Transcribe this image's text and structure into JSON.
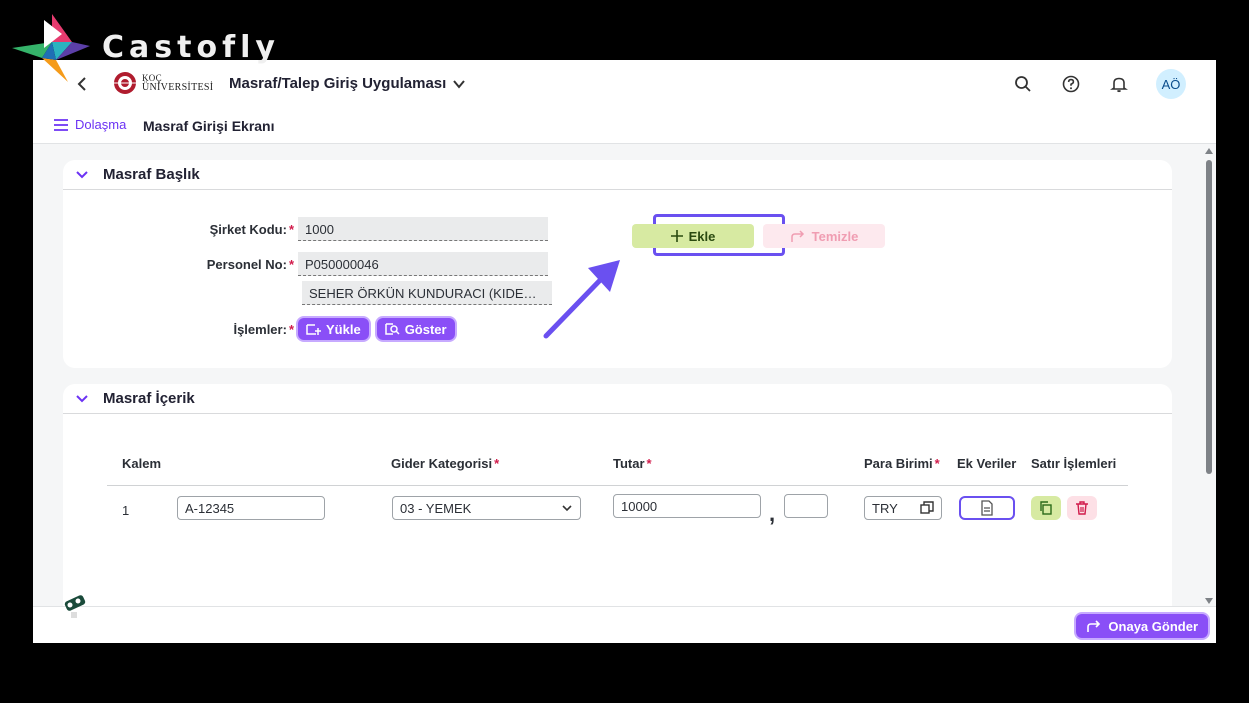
{
  "watermark": {
    "text": "Castofly"
  },
  "header": {
    "logo_line1": "KOÇ",
    "logo_line2": "ÜNİVERSİTESİ",
    "app_title": "Masraf/Talep Giriş Uygulaması",
    "avatar_initials": "AÖ"
  },
  "subheader": {
    "nav_label": "Dolaşma",
    "screen_title": "Masraf Girişi Ekranı"
  },
  "panel_header": {
    "title": "Masraf Başlık",
    "fields": {
      "company_label": "Şirket Kodu:",
      "company_value": "1000",
      "personnel_label": "Personel No:",
      "personnel_value": "P050000046",
      "personnel_name": "SEHER ÖRKÜN KUNDURACI (KIDEMLİ...",
      "operations_label": "İşlemler:"
    },
    "buttons": {
      "upload": "Yükle",
      "show": "Göster",
      "add": "Ekle",
      "clear": "Temizle"
    }
  },
  "panel_content": {
    "title": "Masraf İçerik",
    "columns": {
      "item": "Kalem",
      "category": "Gider Kategorisi",
      "amount": "Tutar",
      "currency": "Para Birimi",
      "extra": "Ek Veriler",
      "row_ops": "Satır İşlemleri"
    },
    "rows": [
      {
        "no": "1",
        "code": "A-12345",
        "category": "03 - YEMEK",
        "amount": "10000",
        "decimal_sep": ",",
        "decimal": "",
        "currency": "TRY"
      }
    ]
  },
  "footer": {
    "submit": "Onaya Gönder"
  },
  "colors": {
    "accent": "#8a4ff7",
    "add_bg": "#d7eaa2",
    "clear_bg": "#fde9ee",
    "highlight": "#6a50f0",
    "required": "#d11b4b"
  }
}
